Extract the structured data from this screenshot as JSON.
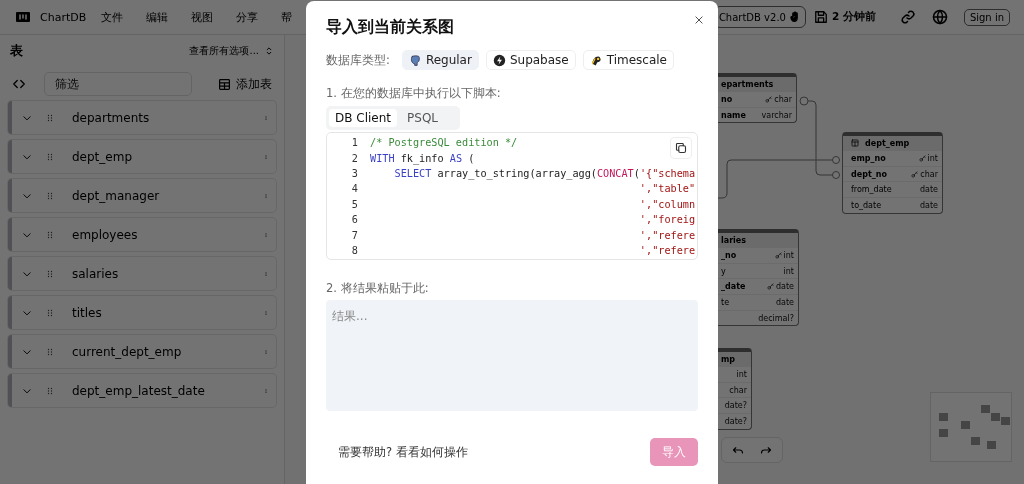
{
  "header": {
    "app_name": "ChartDB",
    "menu": [
      "文件",
      "编辑",
      "视图",
      "分享",
      "帮"
    ],
    "version": "ChartDB v2.0",
    "saved": "2 分钟前",
    "sign_in": "Sign in"
  },
  "sidebar": {
    "title": "表",
    "view_options": "查看所有选项...",
    "filter": {
      "placeholder": "筛选"
    },
    "add_table": "添加表",
    "tables": [
      {
        "name": "departments",
        "expanded": false
      },
      {
        "name": "dept_emp",
        "expanded": false
      },
      {
        "name": "dept_manager",
        "expanded": false
      },
      {
        "name": "employees",
        "expanded": false
      },
      {
        "name": "salaries",
        "expanded": false
      },
      {
        "name": "titles",
        "expanded": false
      },
      {
        "name": "current_dept_emp",
        "expanded": false
      },
      {
        "name": "dept_emp_latest_date",
        "expanded": false
      }
    ]
  },
  "canvas": {
    "tables": [
      {
        "name": "epartments",
        "fields": [
          {
            "name": "no",
            "type": "char",
            "key": true,
            "bold": true
          },
          {
            "name": "name",
            "type": "varchar",
            "key": false,
            "bold": true
          }
        ]
      },
      {
        "name": "dept_emp",
        "fields": [
          {
            "name": "emp_no",
            "type": "int",
            "key": true,
            "bold": true
          },
          {
            "name": "dept_no",
            "type": "char",
            "key": true,
            "bold": true
          },
          {
            "name": "from_date",
            "type": "date",
            "key": false,
            "bold": false
          },
          {
            "name": "to_date",
            "type": "date",
            "key": false,
            "bold": false
          }
        ]
      },
      {
        "name": "laries",
        "fields": [
          {
            "name": "_no",
            "type": "int",
            "key": true,
            "bold": true
          },
          {
            "name": "y",
            "type": "int",
            "key": false,
            "bold": false
          },
          {
            "name": "_date",
            "type": "date",
            "key": true,
            "bold": true
          },
          {
            "name": "te",
            "type": "date",
            "key": false,
            "bold": false
          },
          {
            "type": "decimal?",
            "key": false
          }
        ]
      },
      {
        "name": "mp",
        "fields": [
          {
            "type": "int",
            "key": false
          },
          {
            "type": "char",
            "key": false
          },
          {
            "type": "date?",
            "key": false
          },
          {
            "type": "date?",
            "key": false
          }
        ]
      }
    ]
  },
  "dialog": {
    "title": "导入到当前关系图",
    "db_type_label": "数据库类型:",
    "db_types": [
      {
        "label": "Regular",
        "selected": true
      },
      {
        "label": "Supabase",
        "selected": false
      },
      {
        "label": "Timescale",
        "selected": false
      }
    ],
    "step1": "1. 在您的数据库中执行以下脚本:",
    "tabs": [
      {
        "label": "DB Client",
        "selected": true
      },
      {
        "label": "PSQL",
        "selected": false
      }
    ],
    "code": [
      {
        "number": "1",
        "kind": "top",
        "tokens": [
          {
            "kind": "comment",
            "text": "/* PostgreSQL edition */"
          }
        ]
      },
      {
        "number": "2",
        "kind": "top",
        "tokens": [
          {
            "kind": "keyword",
            "text": "WITH"
          },
          {
            "kind": "plain",
            "text": " fk_info "
          },
          {
            "kind": "keyword",
            "text": "AS"
          },
          {
            "kind": "plain",
            "text": " ("
          }
        ]
      },
      {
        "number": "3",
        "kind": "nested",
        "tokens": [
          {
            "kind": "keyword",
            "text": "SELECT"
          },
          {
            "kind": "plain",
            "text": " array_to_string(array_agg("
          },
          {
            "kind": "func",
            "text": "CONCAT"
          },
          {
            "kind": "plain",
            "text": "("
          },
          {
            "kind": "string",
            "text": "'{\"schema"
          }
        ]
      },
      {
        "number": "4",
        "kind": "continuation",
        "tokens": [
          {
            "kind": "string",
            "text": "',\"table\""
          }
        ]
      },
      {
        "number": "5",
        "kind": "continuation",
        "tokens": [
          {
            "kind": "string",
            "text": "',\"column"
          }
        ]
      },
      {
        "number": "6",
        "kind": "continuation",
        "tokens": [
          {
            "kind": "string",
            "text": "',\"foreig"
          }
        ]
      },
      {
        "number": "7",
        "kind": "continuation",
        "tokens": [
          {
            "kind": "string",
            "text": "',\"refere"
          }
        ]
      },
      {
        "number": "8",
        "kind": "continuation",
        "tokens": [
          {
            "kind": "string",
            "text": "',\"refere"
          }
        ]
      }
    ],
    "step2": "2. 将结果粘贴于此:",
    "result": {
      "placeholder": "结果..."
    },
    "help": {
      "text": "需要帮助? ",
      "link": "看看如何操作"
    },
    "import_button": {
      "label": "导入",
      "disabled": true
    }
  }
}
